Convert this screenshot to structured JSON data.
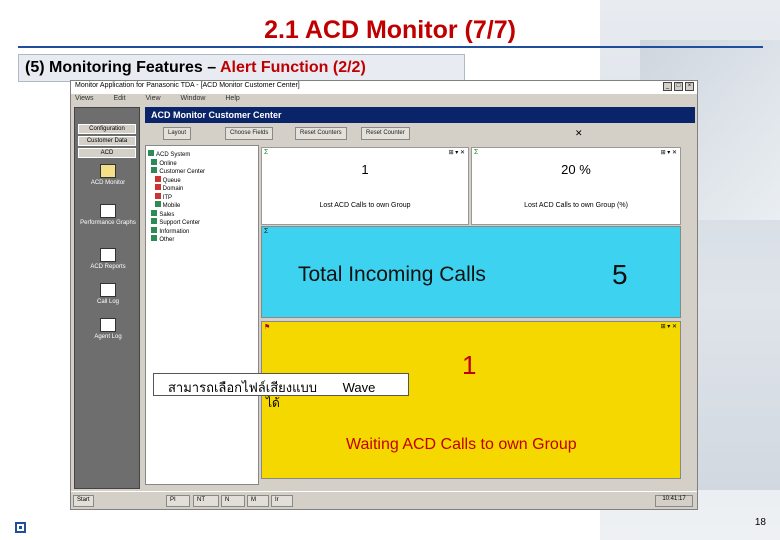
{
  "slide": {
    "title": "2.1 ACD Monitor (7/7)",
    "subtitle_prefix": "(5) Monitoring Features – ",
    "subtitle_highlight": "Alert Function (2/2)",
    "page_number": "18"
  },
  "window": {
    "title": "Monitor Application for Panasonic TDA - [ACD Monitor Customer Center]",
    "menu": [
      "Views",
      "Edit",
      "View",
      "Window",
      "Help"
    ],
    "header": "ACD Monitor Customer Center"
  },
  "left_panel": {
    "buttons": [
      "Configuration",
      "Customer Data",
      "ACD"
    ],
    "items": [
      "ACD Monitor",
      "Performance Graphs",
      "ACD Reports",
      "Call Log",
      "Agent Log"
    ]
  },
  "toolbar": {
    "buttons": [
      "Layout",
      "Choose Fields",
      "Reset Counters",
      "Reset Counter"
    ]
  },
  "tree": {
    "items": [
      "ACD System",
      "Online",
      "Customer Center",
      "Queue",
      "Domain",
      "ITP",
      "Mobile",
      "Sales",
      "Support Center",
      "Information",
      "Other"
    ]
  },
  "metric_left": {
    "value": "1",
    "caption": "Lost ACD Calls to own Group"
  },
  "metric_right": {
    "value": "20 %",
    "caption": "Lost ACD Calls to own Group (%)"
  },
  "panel_blue": {
    "label": "Total Incoming Calls",
    "value": "5",
    "color": "#3cd2f0"
  },
  "panel_yellow": {
    "label": "Waiting ACD Calls to own Group",
    "value": "1",
    "color": "#f5d800"
  },
  "callout": {
    "thai": "สามารถเลือกไฟล์เสียงแบบ",
    "wave": "Wave",
    "suffix": "ได้"
  },
  "taskbar": {
    "start": "Start",
    "items": [
      "PI",
      "NT",
      "N",
      "M",
      "Ir"
    ],
    "clock": "10:41:17"
  }
}
